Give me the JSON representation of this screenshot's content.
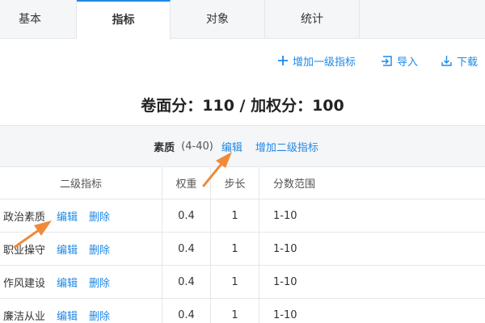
{
  "tabs": [
    {
      "label": "基本",
      "active": false
    },
    {
      "label": "指标",
      "active": true
    },
    {
      "label": "对象",
      "active": false
    },
    {
      "label": "统计",
      "active": false
    }
  ],
  "toolbar": {
    "add_label": "增加一级指标",
    "import_label": "导入",
    "download_label": "下载"
  },
  "score_title": "卷面分：110 / 加权分：100",
  "section": {
    "name": "素质",
    "range": "(4-40)",
    "edit_label": "编辑",
    "add_sub_label": "增加二级指标"
  },
  "table": {
    "headers": [
      "二级指标",
      "权重",
      "步长",
      "分数范围"
    ],
    "rows": [
      {
        "name": "政治素质",
        "edit": "编辑",
        "delete": "删除",
        "weight": "0.4",
        "step": "1",
        "range": "1-10"
      },
      {
        "name": "职业操守",
        "edit": "编辑",
        "delete": "删除",
        "weight": "0.4",
        "step": "1",
        "range": "1-10"
      },
      {
        "name": "作风建设",
        "edit": "编辑",
        "delete": "删除",
        "weight": "0.4",
        "step": "1",
        "range": "1-10"
      },
      {
        "name": "廉洁从业",
        "edit": "编辑",
        "delete": "删除",
        "weight": "0.4",
        "step": "1",
        "range": "1-10"
      }
    ]
  },
  "colors": {
    "accent": "#1e88e5",
    "annotation_arrow": "#f08a3a"
  }
}
